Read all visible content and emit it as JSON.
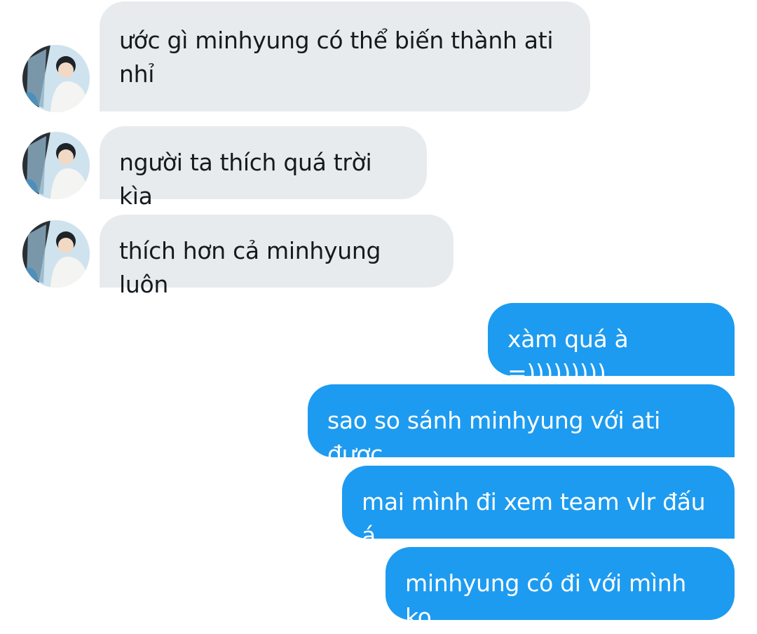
{
  "colors": {
    "incoming_bubble": "#e7ebee",
    "outgoing_bubble": "#1d9bf0",
    "incoming_text": "#151a1e",
    "outgoing_text": "#ffffff"
  },
  "avatar": {
    "icon": "profile-photo-avatar"
  },
  "messages": [
    {
      "direction": "incoming",
      "text": "ước gì minhyung có thể biến thành ati nhỉ"
    },
    {
      "direction": "incoming",
      "text": "người ta thích quá trời kìa"
    },
    {
      "direction": "incoming",
      "text": "thích hơn cả minhyung luôn"
    },
    {
      "direction": "outgoing",
      "text": "xàm quá à =)))))))))"
    },
    {
      "direction": "outgoing",
      "text": "sao so sánh minhyung với ati được"
    },
    {
      "direction": "outgoing",
      "text": "mai mình đi xem team vlr đấu á"
    },
    {
      "direction": "outgoing",
      "text": "minhyung có đi với mình ko"
    }
  ]
}
